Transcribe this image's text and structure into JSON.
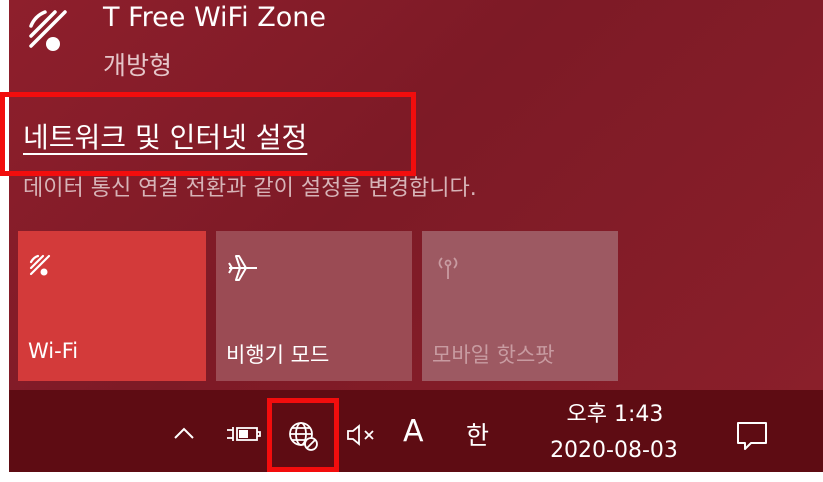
{
  "network": {
    "name": "T Free WiFi Zone",
    "status": "개방형",
    "icon": "wifi-icon"
  },
  "settings": {
    "link_label": "네트워크 및 인터넷 설정",
    "description": "데이터 통신 연결 전환과 같이 설정을 변경합니다."
  },
  "quick_actions": [
    {
      "label": "Wi-Fi",
      "icon": "wifi-icon",
      "state": "on"
    },
    {
      "label": "비행기 모드",
      "icon": "airplane-icon",
      "state": "off"
    },
    {
      "label": "모바일 핫스팟",
      "icon": "hotspot-icon",
      "state": "disabled"
    }
  ],
  "taskbar": {
    "ime_mode": "A",
    "ime_lang": "한",
    "time": "오후 1:43",
    "date": "2020-08-03",
    "icons": [
      "chevron-up-icon",
      "battery-charging-icon",
      "globe-no-internet-icon",
      "speaker-muted-icon",
      "notification-icon"
    ]
  },
  "colors": {
    "flyout_bg": "#8e1f2c",
    "taskbar_bg": "#5e0c13",
    "active_tile": "#d33a3a",
    "highlight": "#f20d0d"
  }
}
